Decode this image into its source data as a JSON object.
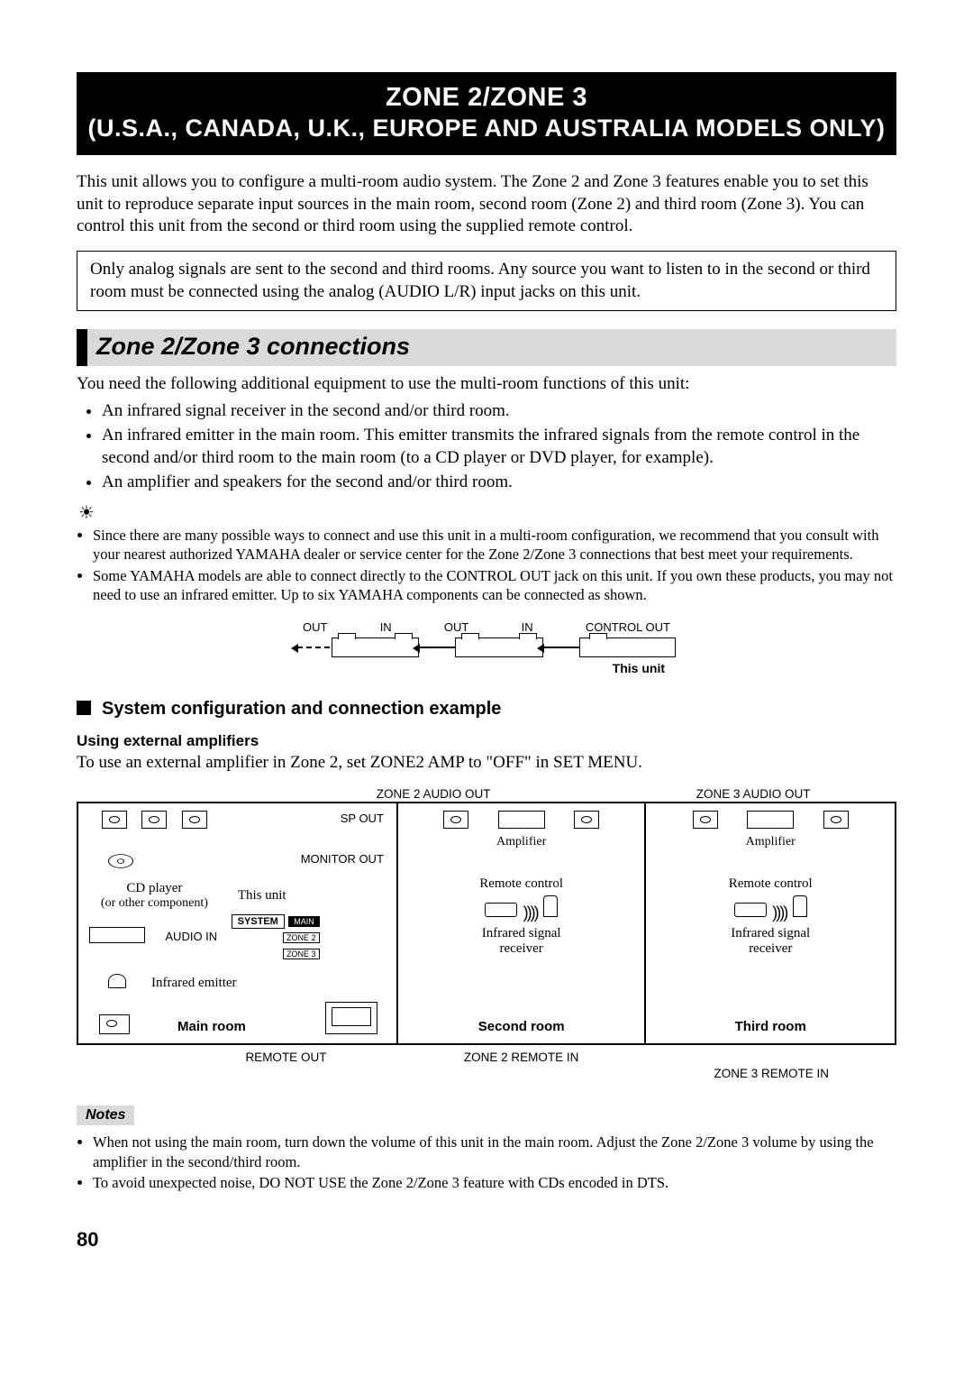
{
  "title": {
    "main": "ZONE 2/ZONE 3",
    "sub": "(U.S.A., CANADA, U.K., EUROPE AND AUSTRALIA MODELS ONLY)"
  },
  "intro": "This unit allows you to configure a multi-room audio system. The Zone 2 and Zone 3 features enable you to set this unit to reproduce separate input sources in the main room, second room (Zone 2) and third room (Zone 3). You can control this unit from the second or third room using the supplied remote control.",
  "analog_note": "Only analog signals are sent to the second and third rooms. Any source you want to listen to in the second or third room must be connected using the analog (AUDIO L/R) input jacks on this unit.",
  "section_heading": "Zone 2/Zone 3 connections",
  "equipment_intro": "You need the following additional equipment to use the multi-room functions of this unit:",
  "equipment": [
    "An infrared signal receiver in the second and/or third room.",
    "An infrared emitter in the main room. This emitter transmits the infrared signals from the remote control in the second and/or third room to the main room (to a CD player or DVD player, for example).",
    "An amplifier and speakers for the second and/or third room."
  ],
  "tips": [
    "Since there are many possible ways to connect and use this unit in a multi-room configuration, we recommend that you consult with your nearest authorized YAMAHA dealer or service center for the Zone 2/Zone 3 connections that best meet your requirements.",
    "Some YAMAHA models are able to connect directly to the CONTROL OUT jack on this unit. If you own these products, you may not need to use an infrared emitter. Up to six YAMAHA components can be connected as shown."
  ],
  "diagram1": {
    "out": "OUT",
    "in": "IN",
    "control_out": "CONTROL OUT",
    "this_unit": "This unit"
  },
  "subsection": "System configuration and connection example",
  "using_ext": "Using external amplifiers",
  "using_ext_body": "To use an external amplifier in Zone 2, set ZONE2 AMP to \"OFF\" in SET MENU.",
  "diagram2": {
    "zone2_audio_out": "ZONE 2 AUDIO OUT",
    "zone3_audio_out": "ZONE 3 AUDIO OUT",
    "sp_out": "SP OUT",
    "monitor_out": "MONITOR OUT",
    "cd_player": "CD player",
    "or_other": "(or other component)",
    "this_unit": "This unit",
    "audio_in": "AUDIO IN",
    "system": "SYSTEM",
    "chip_main": "MAIN",
    "chip_z2": "ZONE 2",
    "chip_z3": "ZONE 3",
    "infrared_emitter": "Infrared emitter",
    "main_room": "Main room",
    "amplifier": "Amplifier",
    "remote_control": "Remote control",
    "ir_receiver_l1": "Infrared signal",
    "ir_receiver_l2": "receiver",
    "second_room": "Second room",
    "third_room": "Third room",
    "remote_out": "REMOTE OUT",
    "zone2_remote_in": "ZONE 2 REMOTE IN",
    "zone3_remote_in": "ZONE 3 REMOTE IN"
  },
  "notes_heading": "Notes",
  "notes": [
    "When not using the main room, turn down the volume of this unit in the main room. Adjust the Zone 2/Zone 3 volume by using the amplifier in the second/third room.",
    "To avoid unexpected noise, DO NOT USE the Zone 2/Zone 3 feature with CDs encoded in DTS."
  ],
  "page_number": "80"
}
